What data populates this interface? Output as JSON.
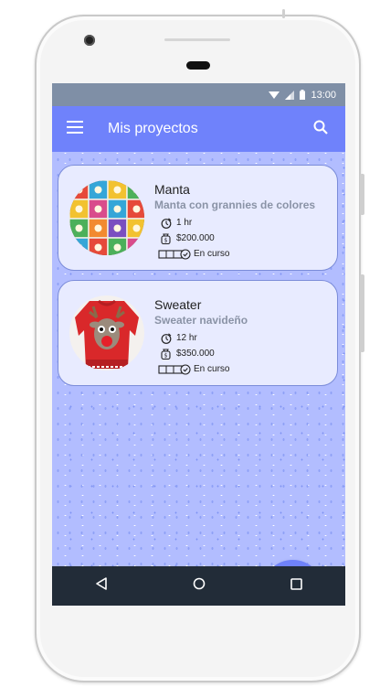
{
  "status_bar": {
    "time": "13:00",
    "icons": [
      "wifi-icon",
      "signal-icon",
      "battery-icon"
    ]
  },
  "app_bar": {
    "title": "Mis proyectos",
    "menu_icon": "hamburger-menu-icon",
    "search_icon": "search-icon"
  },
  "projects": [
    {
      "name": "Manta",
      "description": "Manta con grannies de colores",
      "time": "1 hr",
      "cost": "$200.000",
      "status": "En curso",
      "image": "granny-square-blanket"
    },
    {
      "name": "Sweater",
      "description": "Sweater navideño",
      "time": "12 hr",
      "cost": "$350.000",
      "status": "En curso",
      "image": "reindeer-christmas-sweater"
    }
  ],
  "fab": {
    "icon": "plus-icon"
  },
  "nav_bar": {
    "buttons": [
      "back-icon",
      "home-icon",
      "recents-icon"
    ]
  },
  "colors": {
    "primary": "#6f82fb",
    "background": "#b2bdff",
    "card": "#e8ebff",
    "status_bar": "#7f8fa6",
    "nav_bar": "#222c38"
  }
}
